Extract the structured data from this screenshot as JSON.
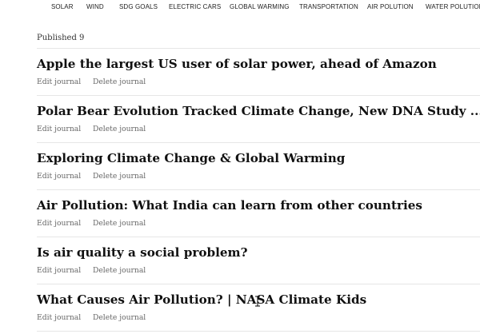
{
  "nav": {
    "items": [
      "SOLAR",
      "WIND",
      "SDG GOALS",
      "ELECTRIC CARS",
      "GLOBAL WARMING",
      "TRANSPORTATION",
      "AIR POLUTION",
      "WATER POLUTION"
    ]
  },
  "published_label": "Published 9",
  "articles": [
    {
      "title": "Apple the largest US user of solar power, ahead of Amazon",
      "edit": "Edit journal",
      "delete": "Delete journal"
    },
    {
      "title": "Polar Bear Evolution Tracked Climate Change, New DNA Study ...",
      "edit": "Edit journal",
      "delete": "Delete journal"
    },
    {
      "title": "Exploring Climate Change & Global Warming",
      "edit": "Edit journal",
      "delete": "Delete journal"
    },
    {
      "title": "Air Pollution: What India can learn from other countries",
      "edit": "Edit journal",
      "delete": "Delete journal"
    },
    {
      "title": "Is air quality a social problem?",
      "edit": "Edit journal",
      "delete": "Delete journal"
    },
    {
      "title": "What Causes Air Pollution? | NASA Climate Kids",
      "edit": "Edit journal",
      "delete": "Delete journal"
    }
  ]
}
